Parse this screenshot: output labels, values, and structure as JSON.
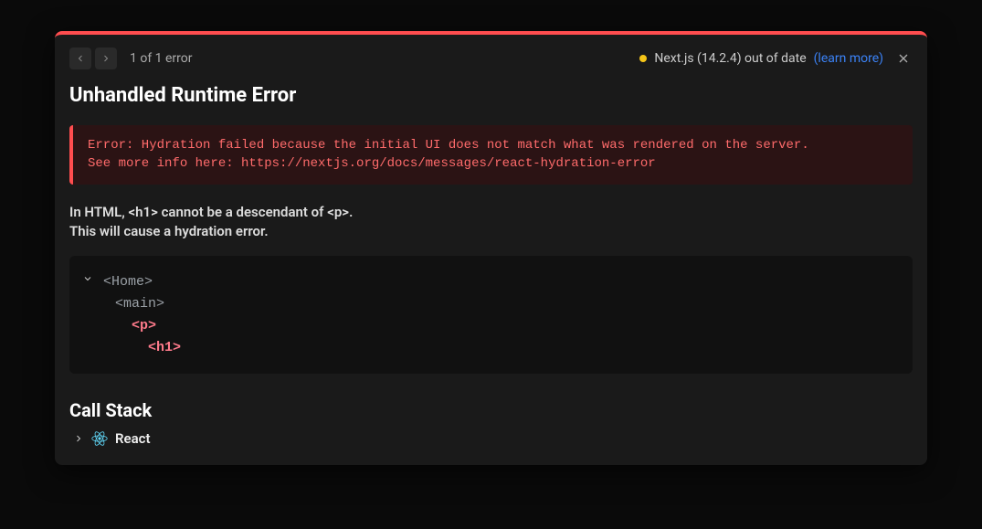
{
  "nav": {
    "error_count": "1 of 1 error"
  },
  "status": {
    "text": "Next.js (14.2.4) out of date",
    "learn_more": "(learn more)"
  },
  "title": "Unhandled Runtime Error",
  "error": {
    "line1": "Error: Hydration failed because the initial UI does not match what was rendered on the server.",
    "line2": "See more info here: https://nextjs.org/docs/messages/react-hydration-error"
  },
  "secondary": {
    "line1": "In HTML, <h1> cannot be a descendant of <p>.",
    "line2": "This will cause a hydration error."
  },
  "tree": {
    "home": "<Home>",
    "main": "<main>",
    "p": "<p>",
    "h1": "<h1>"
  },
  "callstack": {
    "title": "Call Stack",
    "item": "React"
  }
}
